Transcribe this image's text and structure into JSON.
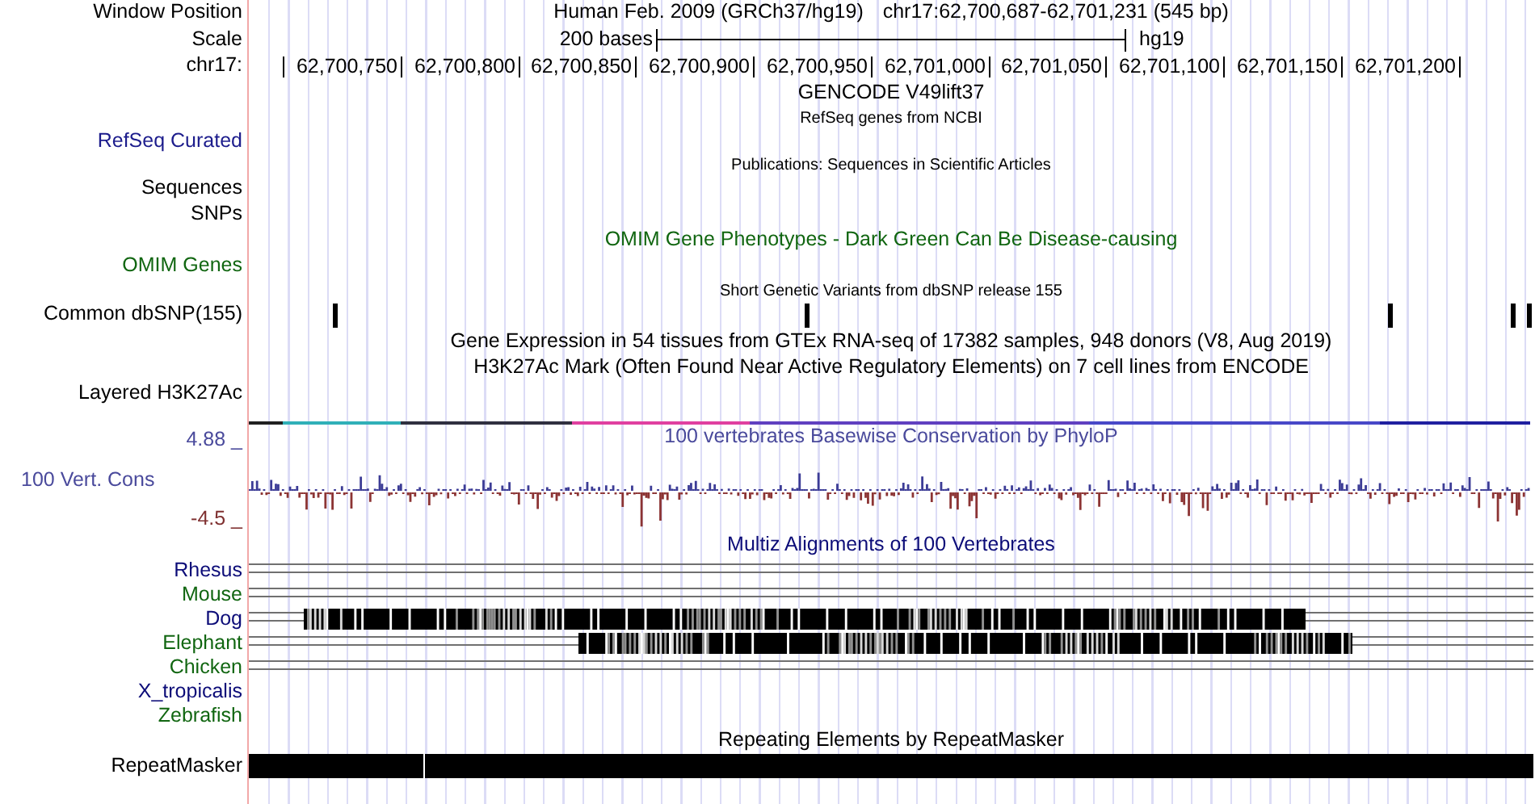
{
  "header": {
    "label": "Window Position",
    "assembly": "Human Feb. 2009 (GRCh37/hg19)",
    "position": "chr17:62,700,687-62,701,231 (545 bp)"
  },
  "scale": {
    "label": "Scale",
    "length": "200 bases",
    "assembly": "hg19"
  },
  "ruler": {
    "label": "chr17:",
    "ticks": [
      "62,700,750",
      "62,700,800",
      "62,700,850",
      "62,700,900",
      "62,700,950",
      "62,701,000",
      "62,701,050",
      "62,701,100",
      "62,701,150",
      "62,701,200"
    ]
  },
  "tracks": [
    {
      "kind": "title",
      "title": "GENCODE V49lift37"
    },
    {
      "kind": "note",
      "title": "RefSeq genes from NCBI"
    },
    {
      "kind": "label",
      "label": "RefSeq Curated",
      "color": "#1c1c8c"
    },
    {
      "kind": "note",
      "title": "Publications: Sequences in Scientific Articles"
    },
    {
      "kind": "label",
      "label": "Sequences"
    },
    {
      "kind": "label",
      "label": "SNPs"
    },
    {
      "kind": "title",
      "title": "OMIM Gene Phenotypes - Dark Green Can Be Disease-causing",
      "color": "#116611"
    },
    {
      "kind": "label",
      "label": "OMIM Genes",
      "color": "#116611"
    },
    {
      "kind": "note",
      "title": "Short Genetic Variants from dbSNP release 155"
    },
    {
      "kind": "snps",
      "label": "Common dbSNP(155)"
    },
    {
      "kind": "title",
      "title": "Gene Expression in 54 tissues from GTEx RNA-seq of 17382 samples, 948 donors (V8, Aug 2019)"
    },
    {
      "kind": "title",
      "title": "H3K27Ac Mark (Often Found Near Active Regulatory Elements) on 7 cell lines from ENCODE"
    },
    {
      "kind": "layered",
      "label": "Layered H3K27Ac"
    },
    {
      "kind": "wiggle",
      "title": "100 vertebrates Basewise Conservation by PhyloP",
      "label": "100 Vert. Cons",
      "max": "4.88 _",
      "min": "-4.5 _",
      "color": "#4a4a9c"
    },
    {
      "kind": "title",
      "title": "Multiz Alignments of 100 Vertebrates",
      "color": "#0c0c78"
    },
    {
      "kind": "gapped",
      "label": "Rhesus",
      "color": "#0c0c78"
    },
    {
      "kind": "gapped",
      "label": "Mouse",
      "color": "#116611"
    },
    {
      "kind": "aligned",
      "label": "Dog",
      "color": "#0c0c78"
    },
    {
      "kind": "aligned",
      "label": "Elephant",
      "color": "#116611"
    },
    {
      "kind": "gapped",
      "label": "Chicken",
      "color": "#116611"
    },
    {
      "kind": "species",
      "label": "X_tropicalis",
      "color": "#0c0c78"
    },
    {
      "kind": "species",
      "label": "Zebrafish",
      "color": "#116611"
    },
    {
      "kind": "title",
      "title": "Repeating Elements by RepeatMasker"
    },
    {
      "kind": "bar",
      "label": "RepeatMasker"
    }
  ]
}
